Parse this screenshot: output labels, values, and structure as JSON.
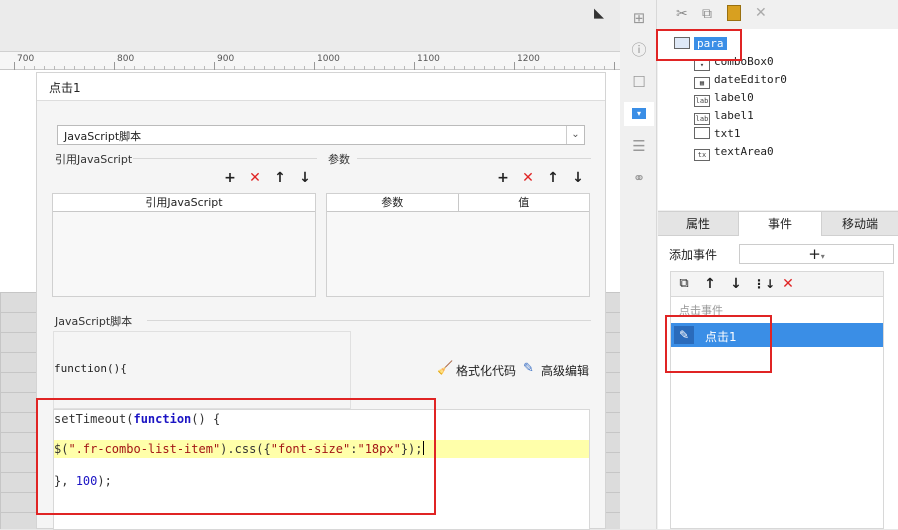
{
  "ruler": {
    "labels": [
      "700",
      "800",
      "900",
      "1000",
      "1100",
      "1200"
    ]
  },
  "dialog": {
    "title": "点击1",
    "script_type": "JavaScript脚本",
    "ref_section_label": "引用JavaScript",
    "ref_column_header": "引用JavaScript",
    "param_section_label": "参数",
    "param_col1": "参数",
    "param_col2": "值",
    "script_section_label": "JavaScript脚本",
    "code_prefix": "function(){",
    "format_label": "格式化代码",
    "advanced_label": "高级编辑"
  },
  "code": {
    "line1": [
      "setTimeout(",
      "function",
      "() {"
    ],
    "line2": [
      "$(",
      "\".fr-combo-list-item\"",
      ").css({",
      "\"font-size\"",
      ":",
      "\"18px\"",
      "});"
    ],
    "line3": [
      "}, ",
      "100",
      ");"
    ]
  },
  "tree": {
    "root": "para",
    "children": [
      {
        "icon": "combobox-icon",
        "label": "comboBox0"
      },
      {
        "icon": "date-editor-icon",
        "label": "dateEditor0"
      },
      {
        "icon": "label-icon",
        "label": "label0"
      },
      {
        "icon": "label-icon",
        "label": "label1"
      },
      {
        "icon": "textbox-icon",
        "label": "txt1"
      },
      {
        "icon": "textarea-icon",
        "label": "textArea0"
      }
    ]
  },
  "tabs": {
    "attr": "属性",
    "event": "事件",
    "mobile": "移动端"
  },
  "events": {
    "add_label": "添加事件",
    "group_label": "点击事件",
    "selected_item": "点击1"
  },
  "colors": {
    "accent": "#3a8ee6",
    "highlight": "#ffffaa",
    "annotation": "#e02424",
    "delete": "#e02424"
  }
}
